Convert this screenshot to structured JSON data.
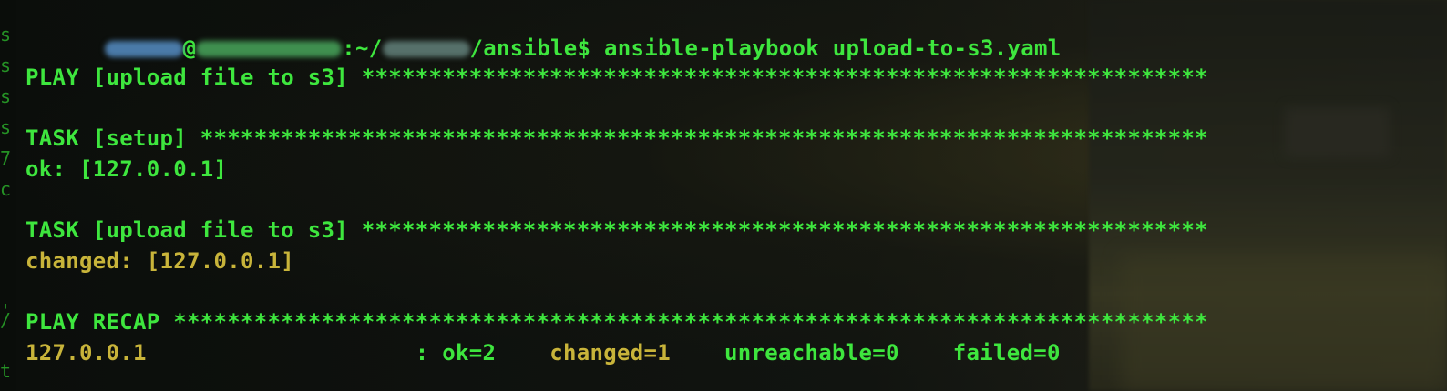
{
  "terminal": {
    "prompt": {
      "user_redacted": "",
      "at": "@",
      "path_prefix": ":~/",
      "path_suffix": "/ansible$ ",
      "command": "ansible-playbook upload-to-s3.yaml"
    },
    "play_header": "PLAY [upload file to s3] ***************************************************************",
    "task_setup_header": "TASK [setup] ***************************************************************************",
    "task_setup_result": "ok: [127.0.0.1]",
    "task_upload_header": "TASK [upload file to s3] ***************************************************************",
    "task_upload_result": "changed: [127.0.0.1]",
    "recap_header": "PLAY RECAP *****************************************************************************",
    "recap": {
      "host": "127.0.0.1",
      "separator": "                    : ",
      "ok": "ok=2",
      "changed": "changed=1",
      "unreachable": "unreachable=0",
      "failed": "failed=0"
    }
  },
  "colors": {
    "green": "#3ee63e",
    "yellow": "#c8b43a",
    "background": "#0d100d"
  }
}
